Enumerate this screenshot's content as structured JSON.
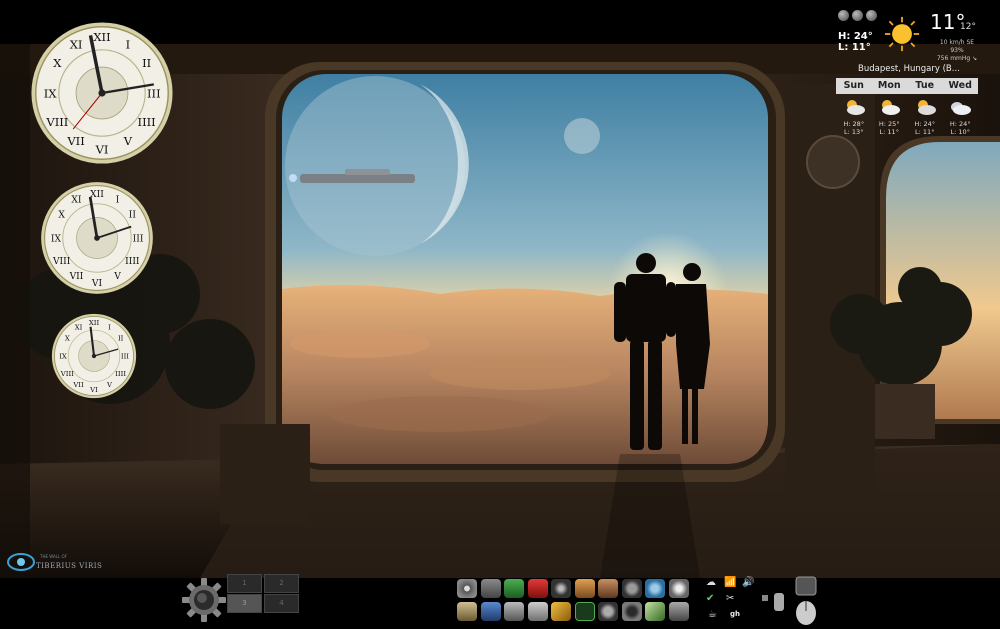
{
  "weather": {
    "high": "H: 24°",
    "low": "L: 11°",
    "temp": "11°",
    "feels": "12°",
    "wind": "10 km/h SE",
    "humidity": "93%",
    "pressure": "756 mmHg ↘",
    "location": "Budapest, Hungary (B...",
    "days": [
      "Sun",
      "Mon",
      "Tue",
      "Wed"
    ],
    "forecast": [
      {
        "hi": "H: 28°",
        "lo": "L: 13°"
      },
      {
        "hi": "H: 25°",
        "lo": "L: 11°"
      },
      {
        "hi": "H: 24°",
        "lo": "L: 11°"
      },
      {
        "hi": "H: 24°",
        "lo": "L: 10°"
      }
    ]
  },
  "logo": {
    "text": "TIBERIUS VIRIS",
    "sub": "THE WALL OF"
  },
  "workspaces": [
    "1",
    "2",
    "3",
    "4"
  ],
  "tray": {
    "gh_label": "gh"
  },
  "colors": {
    "sky_top": "#4f8fb0",
    "horizon": "#f5c27a",
    "clouds": "#b98a62",
    "frame": "#3a2d22"
  }
}
